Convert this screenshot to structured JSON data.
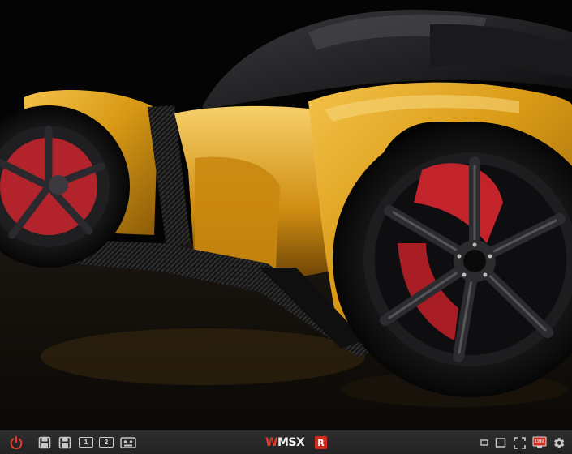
{
  "screen": {
    "image_description_icon": "car-image",
    "colors": {
      "body": "#d99a16",
      "rim": "#1d1d1f",
      "caliper": "#c3232b",
      "background": "#050505"
    }
  },
  "toolbar": {
    "power_icon": "power-icon",
    "disk_icons": [
      "floppy-disk-icon",
      "floppy-disk-icon"
    ],
    "cartridge_slots": [
      {
        "label": "1"
      },
      {
        "label": "2"
      }
    ],
    "tape_icon": "cassette-tape-icon",
    "logo": {
      "part1": "W",
      "part2": "MSX"
    },
    "r_badge": "R",
    "window_icons": [
      "restore-window-icon",
      "maximize-window-icon",
      "fullscreen-icon"
    ],
    "screen_badge": "1999",
    "settings_icon": "gear-icon",
    "colors": {
      "bar": "#2a2a2a",
      "accent": "#e23b2e",
      "icon": "#c8c8c8"
    }
  }
}
